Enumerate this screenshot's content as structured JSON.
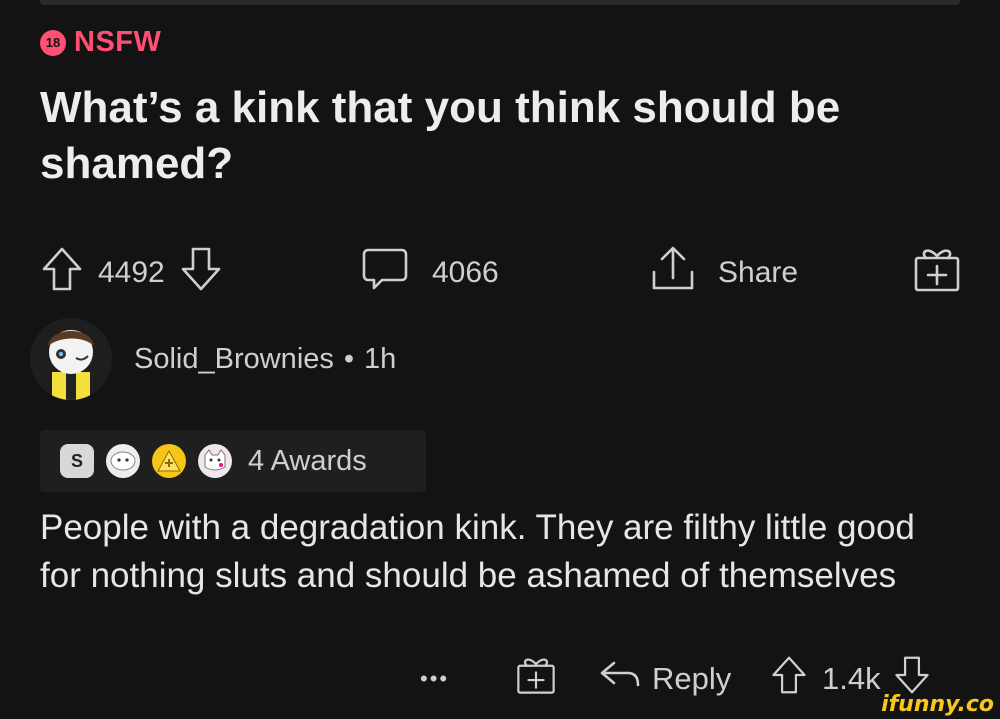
{
  "post": {
    "nsfw_badge": "18",
    "nsfw_label": "NSFW",
    "title": "What’s a kink that you think should be shamed?",
    "votes": "4492",
    "comments": "4066",
    "share_label": "Share"
  },
  "comment": {
    "username": "Solid_Brownies",
    "separator": "•",
    "age": "1h",
    "awards_label": "4 Awards",
    "award_icons": [
      "silver-award-icon",
      "wholesome-award-icon",
      "helpful-award-icon",
      "cat-award-icon"
    ],
    "body": "People with a degradation kink. They are filthy little good for nothing sluts and should be ashamed of themselves",
    "more_label": "•••",
    "reply_label": "Reply",
    "votes": "1.4k"
  },
  "watermark": "ifunny.co",
  "colors": {
    "background": "#131313",
    "nsfw": "#ff4f73",
    "text": "#e2e2e2",
    "icon": "#cfcfcf",
    "watermark": "#f7c719"
  }
}
